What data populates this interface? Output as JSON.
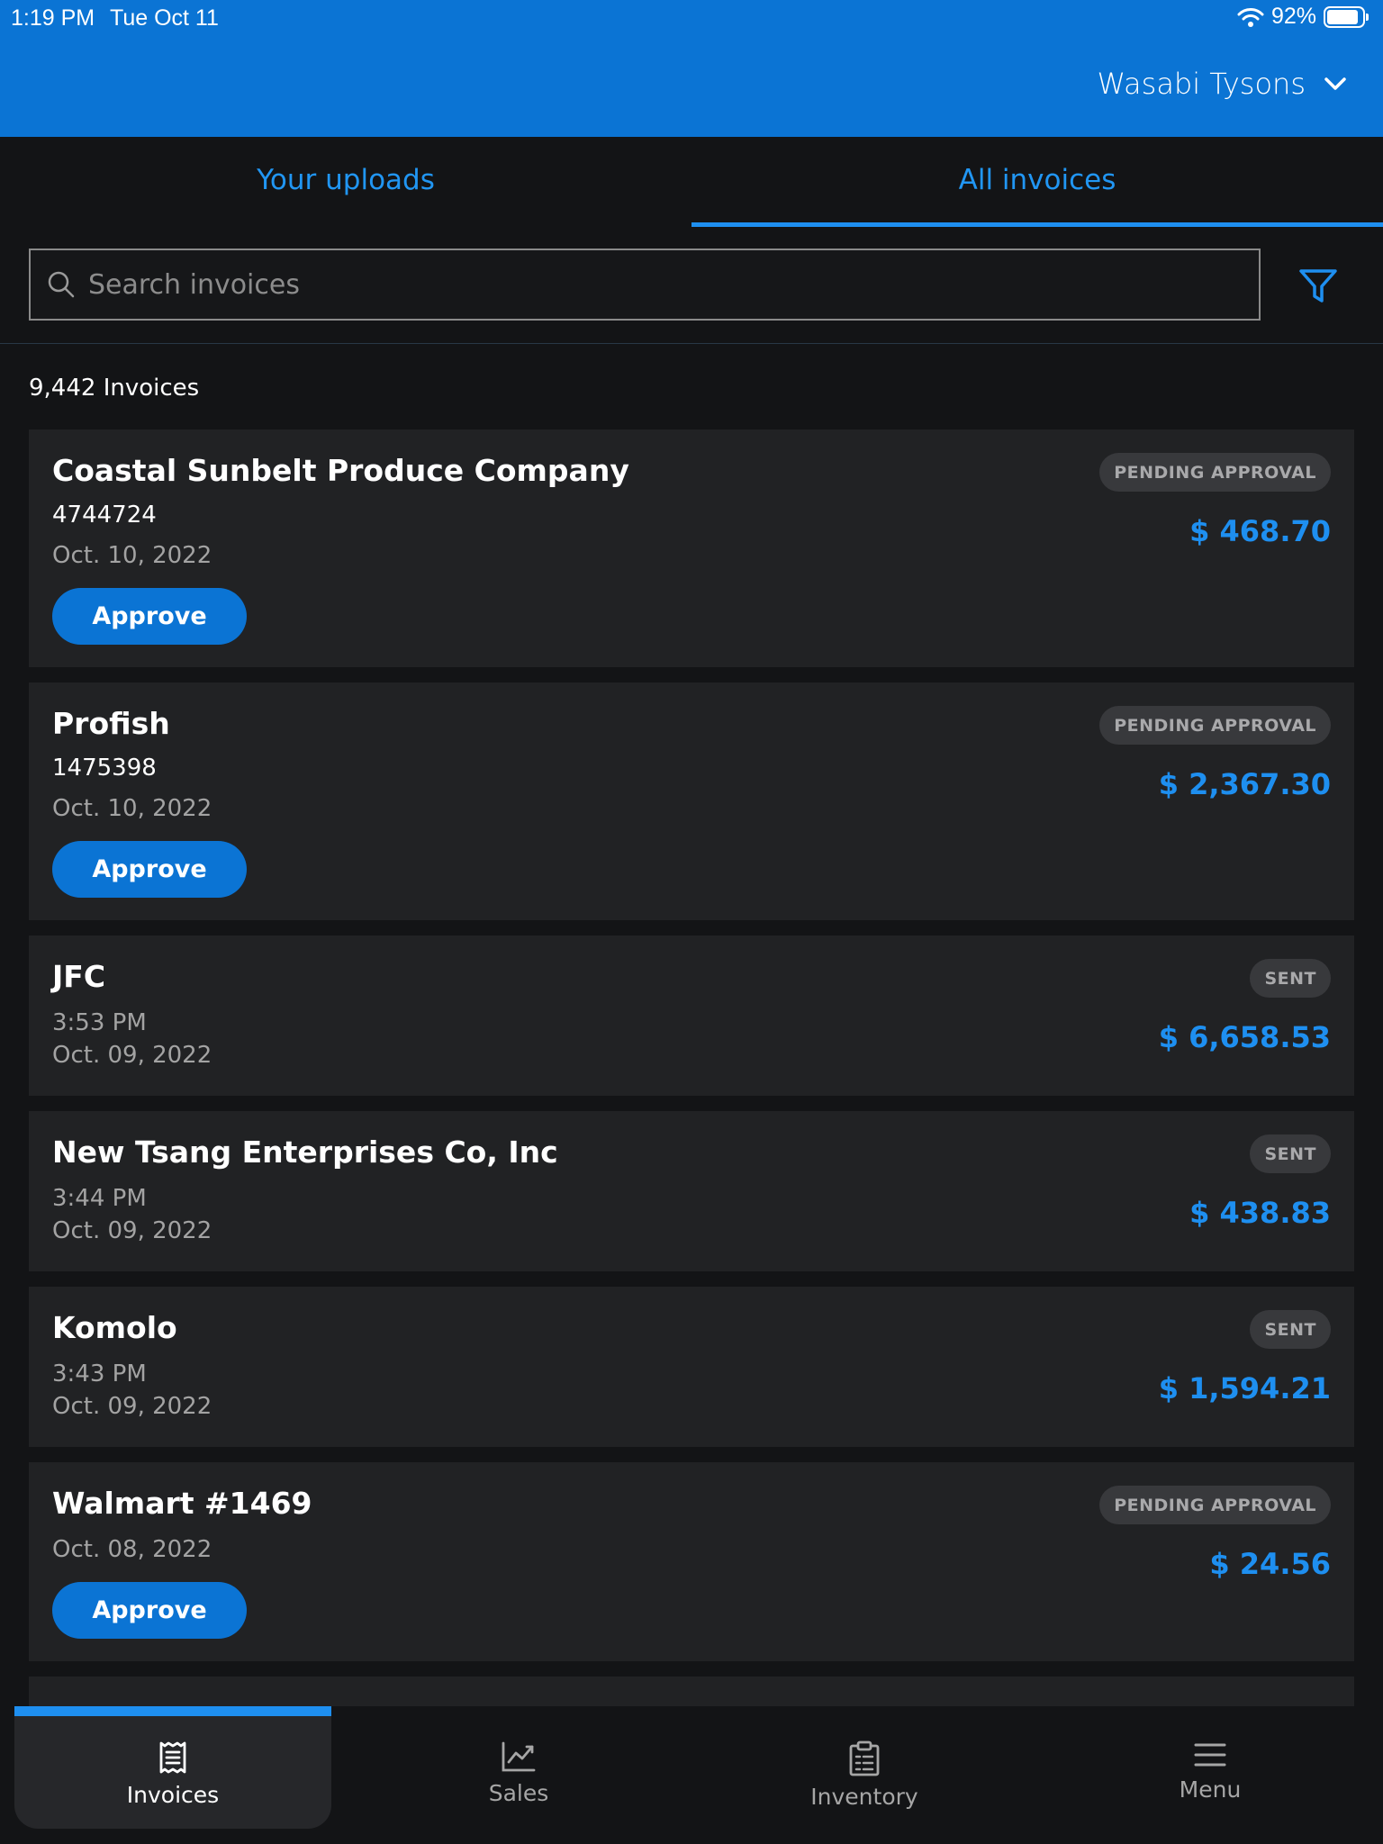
{
  "status_bar": {
    "time": "1:19 PM",
    "date": "Tue Oct 11",
    "battery": "92%"
  },
  "header": {
    "location": "Wasabi Tysons"
  },
  "tabs": [
    {
      "label": "Your uploads",
      "active": false
    },
    {
      "label": "All invoices",
      "active": true
    }
  ],
  "search": {
    "placeholder": "Search invoices",
    "value": ""
  },
  "list": {
    "count_label": "9,442 Invoices"
  },
  "invoices": [
    {
      "vendor": "Coastal Sunbelt Produce Company",
      "number": "4744724",
      "date": "Oct. 10, 2022",
      "status": "PENDING APPROVAL",
      "amount": "$ 468.70",
      "action": "Approve"
    },
    {
      "vendor": "Profish",
      "number": "1475398",
      "date": "Oct. 10, 2022",
      "status": "PENDING APPROVAL",
      "amount": "$ 2,367.30",
      "action": "Approve"
    },
    {
      "vendor": "JFC",
      "time": "3:53 PM",
      "date": "Oct. 09, 2022",
      "status": "SENT",
      "amount": "$ 6,658.53"
    },
    {
      "vendor": "New Tsang Enterprises Co, Inc",
      "time": "3:44 PM",
      "date": "Oct. 09, 2022",
      "status": "SENT",
      "amount": "$ 438.83"
    },
    {
      "vendor": "Komolo",
      "time": "3:43 PM",
      "date": "Oct. 09, 2022",
      "status": "SENT",
      "amount": "$ 1,594.21"
    },
    {
      "vendor": "Walmart #1469",
      "date": "Oct. 08, 2022",
      "status": "PENDING APPROVAL",
      "amount": "$ 24.56",
      "action": "Approve"
    }
  ],
  "nav": [
    {
      "label": "Invoices",
      "icon": "receipt-icon",
      "active": true
    },
    {
      "label": "Sales",
      "icon": "chart-icon",
      "active": false
    },
    {
      "label": "Inventory",
      "icon": "clipboard-icon",
      "active": false
    },
    {
      "label": "Menu",
      "icon": "hamburger-icon",
      "active": false
    }
  ],
  "colors": {
    "brand": "#0b74d4",
    "accent": "#1e8ff0",
    "card": "#212224",
    "background": "#131416"
  }
}
